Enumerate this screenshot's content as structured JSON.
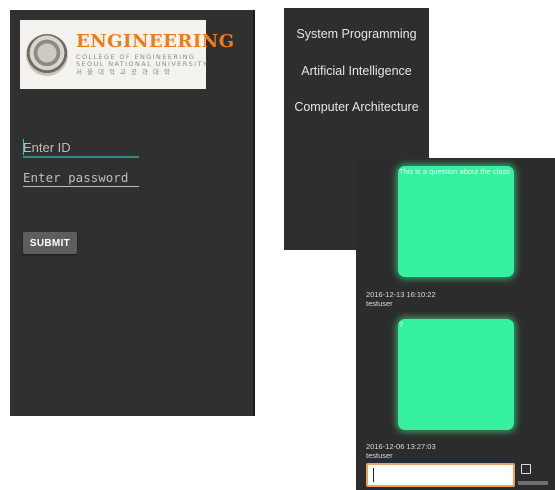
{
  "login": {
    "logo": {
      "title": "ENGINEERING",
      "subtitle_1": "COLLEGE OF ENGINEERING",
      "subtitle_2": "SEOUL NATIONAL UNIVERSITY",
      "korean": "서울대학교공과대학",
      "icon": "university-seal"
    },
    "id_placeholder": "Enter ID",
    "password_placeholder": "Enter password",
    "submit_label": "SUBMIT"
  },
  "courses": {
    "items": [
      {
        "label": "System Programming"
      },
      {
        "label": "Artificial Intelligence"
      },
      {
        "label": "Computer Architecture"
      }
    ]
  },
  "chat": {
    "messages": [
      {
        "text": "This is a question about the class",
        "timestamp": "2016-12-13 16:10:22",
        "user": "testuser"
      },
      {
        "text": "?",
        "timestamp": "2016-12-06 13:27:03",
        "user": "testuser"
      }
    ],
    "input_value": "",
    "bubble_color": "#35f09f",
    "input_border_color": "#f0a05a",
    "send_icon": "checkbox-icon"
  }
}
